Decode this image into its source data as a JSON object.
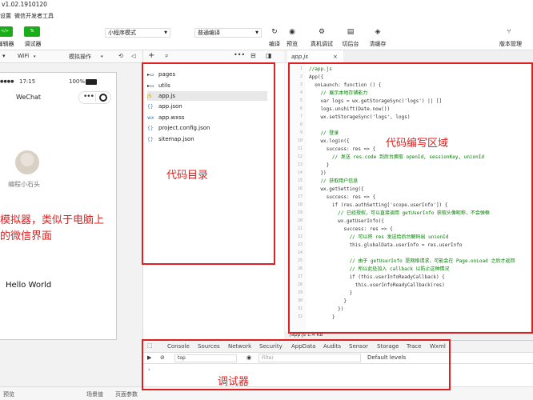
{
  "title": "v1.02.1910120",
  "menu": [
    "设置",
    "微信开发者工具"
  ],
  "toolbar": {
    "editor_label": "编辑器",
    "debugger_label": "调试器",
    "mode_select": "小程序模式",
    "compile_select": "普通编译",
    "buttons": [
      "编译",
      "预览",
      "真机调试",
      "切后台",
      "清缓存"
    ],
    "version_label": "版本管理"
  },
  "simbar": {
    "network": "WiFi",
    "operation": "模拟操作"
  },
  "phone": {
    "time": "17:15",
    "battery": "100%",
    "nav_title": "WeChat",
    "nickname": "编程小石头",
    "hello": "Hello World"
  },
  "tree": {
    "items": [
      {
        "icon": "folder-icon",
        "name": "pages"
      },
      {
        "icon": "folder-icon",
        "name": "utils"
      },
      {
        "icon": "js-file-icon",
        "name": "app.js"
      },
      {
        "icon": "json-file-icon",
        "name": "app.json"
      },
      {
        "icon": "wxss-file-icon",
        "name": "app.wxss"
      },
      {
        "icon": "json-file-icon",
        "name": "project.config.json"
      },
      {
        "icon": "json-file-icon",
        "name": "sitemap.json"
      }
    ]
  },
  "editor": {
    "tab": "app.js",
    "status": "/app.js    1.4 KB",
    "lines": [
      "//app.js",
      "App({",
      "  onLaunch: function () {",
      "    // 展示本地存储能力",
      "    var logs = wx.getStorageSync('logs') || []",
      "    logs.unshift(Date.now())",
      "    wx.setStorageSync('logs', logs)",
      "",
      "    // 登录",
      "    wx.login({",
      "      success: res => {",
      "        // 发送 res.code 到后台换取 openId, sessionKey, unionId",
      "      }",
      "    })",
      "    // 获取用户信息",
      "    wx.getSetting({",
      "      success: res => {",
      "        if (res.authSetting['scope.userInfo']) {",
      "          // 已经授权，可以直接调用 getUserInfo 获取头像昵称，不会弹框",
      "          wx.getUserInfo({",
      "            success: res => {",
      "              // 可以将 res 发送给后台解码出 unionId",
      "              this.globalData.userInfo = res.userInfo",
      "",
      "              // 由于 getUserInfo 是网络请求，可能会在 Page.onLoad 之后才返回",
      "              // 所以此处加入 callback 以防止这种情况",
      "              if (this.userInfoReadyCallback) {",
      "                this.userInfoReadyCallback(res)",
      "              }",
      "            }",
      "          })",
      "        }"
    ]
  },
  "debugger": {
    "tabs": [
      "Console",
      "Sources",
      "Network",
      "Security",
      "AppData",
      "Audits",
      "Sensor",
      "Storage",
      "Trace",
      "Wxml"
    ],
    "context": "top",
    "filter_placeholder": "Filter",
    "levels": "Default levels"
  },
  "bottom": [
    "预览",
    "场景值",
    "页面参数"
  ],
  "annotations": {
    "simulator": "模拟器，类似于电脑上的微信界面",
    "simulator_line1": "模拟器，类似于电脑上",
    "simulator_line2": "的微信界面",
    "tree": "代码目录",
    "editor": "代码编写区域",
    "debugger": "调试器"
  },
  "colors": {
    "accent": "#1aad19",
    "annotation": "#e02020"
  }
}
